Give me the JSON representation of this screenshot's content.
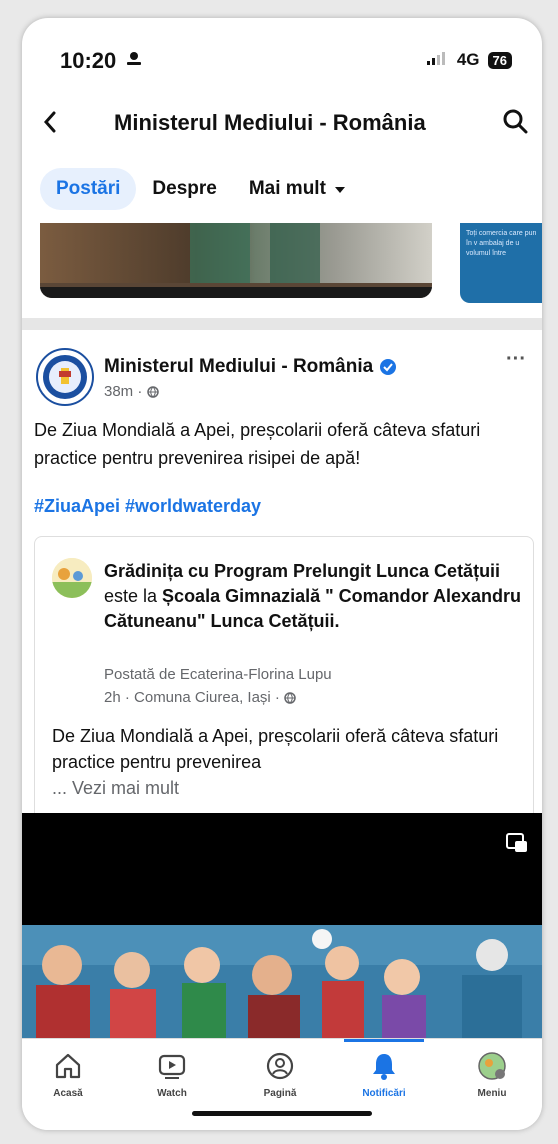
{
  "status": {
    "time": "10:20",
    "network": "4G",
    "battery": "76"
  },
  "header": {
    "back": "<",
    "title": "Ministerul Mediului - România"
  },
  "tabs": [
    {
      "label": "Postări"
    },
    {
      "label": "Despre"
    },
    {
      "label": "Mai mult"
    }
  ],
  "carousel": {
    "card2_text": "Toți comercia care pun în v ambalaj de u volumul între"
  },
  "post": {
    "author": "Ministerul Mediului - România",
    "time": "38m",
    "text": "De Ziua Mondială a Apei, preșcolarii oferă câteva sfaturi practice pentru prevenirea risipei de apă!",
    "hashtags": "#ZiuaApei #worldwaterday",
    "more": "···"
  },
  "shared": {
    "page": "Grădinița cu Program Prelungit Lunca Cetățuii",
    "connector": " este la ",
    "location": "Școala Gimnazială \" Comandor Alexandru Cătuneanu\" Lunca Cetățuii.",
    "posted_by": "Postată de Ecaterina-Florina Lupu",
    "meta": "2h · Comuna Ciurea, Iași ·",
    "text": "De Ziua Mondială a Apei, preșcolarii oferă câteva sfaturi practice pentru prevenirea",
    "see_more": "... Vezi mai mult"
  },
  "nav": [
    {
      "label": "Acasă"
    },
    {
      "label": "Watch"
    },
    {
      "label": "Pagină"
    },
    {
      "label": "Notificări"
    },
    {
      "label": "Meniu"
    }
  ],
  "colors": {
    "accent": "#1b74e4",
    "verified": "#1b74e4"
  }
}
